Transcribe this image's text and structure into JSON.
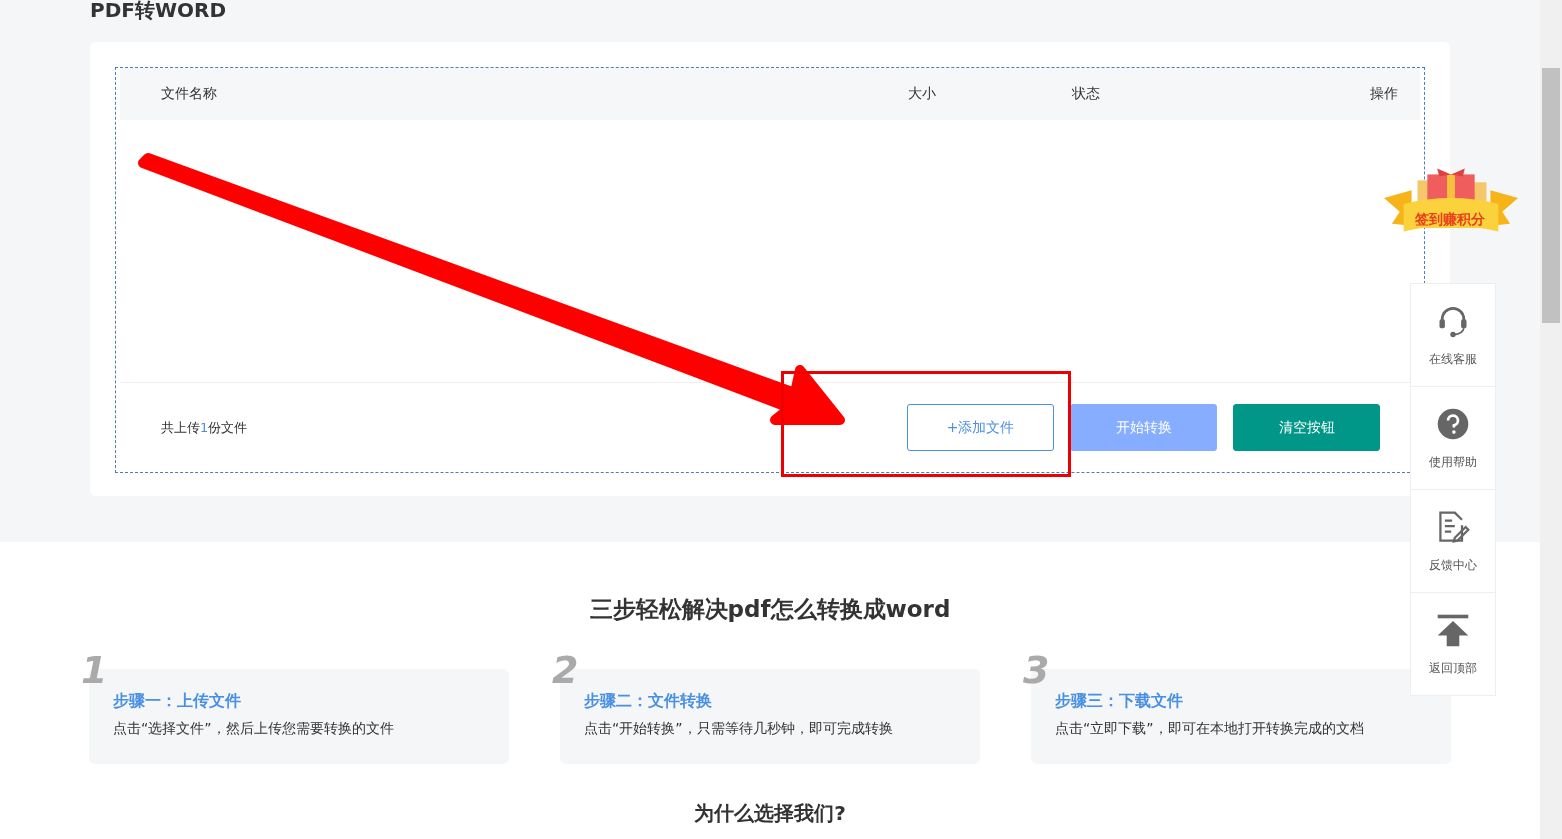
{
  "page_title": "PDF转WORD",
  "table": {
    "columns": [
      "文件名称",
      "大小",
      "状态",
      "操作"
    ]
  },
  "footer": {
    "count_prefix": "共上传",
    "count": "1",
    "count_suffix": "份文件"
  },
  "buttons": [
    {
      "label": "+添加文件",
      "kind": "outline"
    },
    {
      "label": "开始转换",
      "kind": "light"
    },
    {
      "label": "清空按钮",
      "kind": "teal"
    }
  ],
  "badge": {
    "label": "签到赚积分"
  },
  "side_toolbar": [
    {
      "label": "在线客服",
      "kind": "service"
    },
    {
      "label": "使用帮助",
      "kind": "help"
    },
    {
      "label": "反馈中心",
      "kind": "feedback"
    },
    {
      "label": "返回顶部",
      "kind": "top"
    }
  ],
  "steps_title": "三步轻松解决pdf怎么转换成word",
  "steps": [
    {
      "number": "1",
      "title": "步骤一：上传文件",
      "text": "点击“选择文件”，然后上传您需要转换的文件"
    },
    {
      "number": "2",
      "title": "步骤二：文件转换",
      "text": "点击“开始转换”，只需等待几秒钟，即可完成转换"
    },
    {
      "number": "3",
      "title": "步骤三：下载文件",
      "text": "点击“立即下载”，即可在本地打开转换完成的文档"
    }
  ],
  "why_title": "为什么选择我们?"
}
